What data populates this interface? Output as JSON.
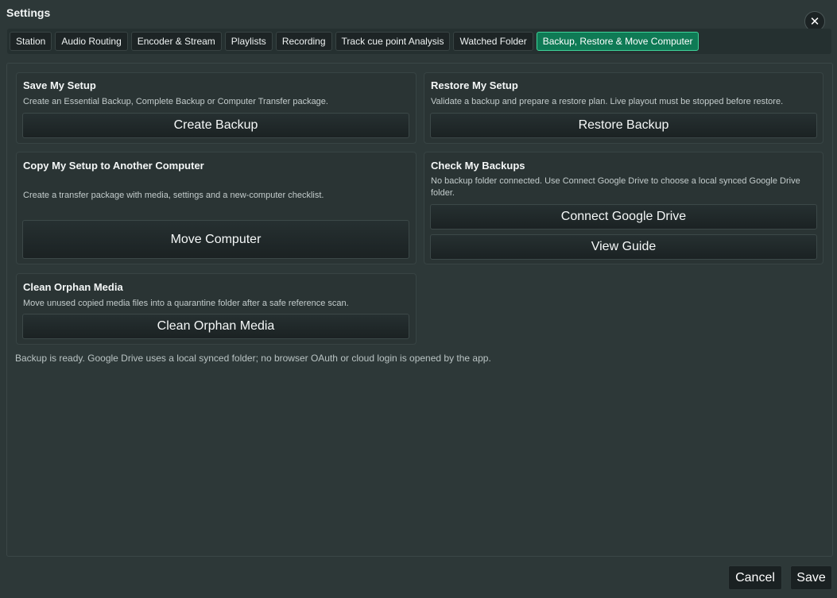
{
  "window": {
    "title": "Settings",
    "close_symbol": "✕"
  },
  "tabs": [
    {
      "label": "Station"
    },
    {
      "label": "Audio Routing"
    },
    {
      "label": "Encoder & Stream"
    },
    {
      "label": "Playlists"
    },
    {
      "label": "Recording"
    },
    {
      "label": "Track cue point Analysis"
    },
    {
      "label": "Watched Folder"
    },
    {
      "label": "Backup, Restore & Move Computer",
      "active": true
    }
  ],
  "cards": {
    "save": {
      "title": "Save My Setup",
      "desc": "Create an Essential Backup, Complete Backup or Computer Transfer package.",
      "button": "Create Backup"
    },
    "restore": {
      "title": "Restore My Setup",
      "desc": "Validate a backup and prepare a restore plan. Live playout must be stopped before restore.",
      "button": "Restore Backup"
    },
    "copy": {
      "title": "Copy My Setup to Another Computer",
      "desc": "Create a transfer package with media, settings and a new-computer checklist.",
      "button": "Move Computer"
    },
    "check": {
      "title": "Check My Backups",
      "desc": "No backup folder connected. Use Connect Google Drive to choose a local synced Google Drive folder.",
      "button_connect": "Connect Google Drive",
      "button_guide": "View Guide"
    },
    "clean": {
      "title": "Clean Orphan Media",
      "desc": "Move unused copied media files into a quarantine folder after a safe reference scan.",
      "button": "Clean Orphan Media"
    }
  },
  "status_text": "Backup is ready. Google Drive uses a local synced folder; no browser OAuth or cloud login is opened by the app.",
  "footer": {
    "cancel": "Cancel",
    "save": "Save"
  },
  "colors": {
    "background": "#2d3838",
    "active_tab": "#0f7a55",
    "active_tab_border": "#3fd49a"
  },
  "icons": {
    "close": "close-icon"
  }
}
